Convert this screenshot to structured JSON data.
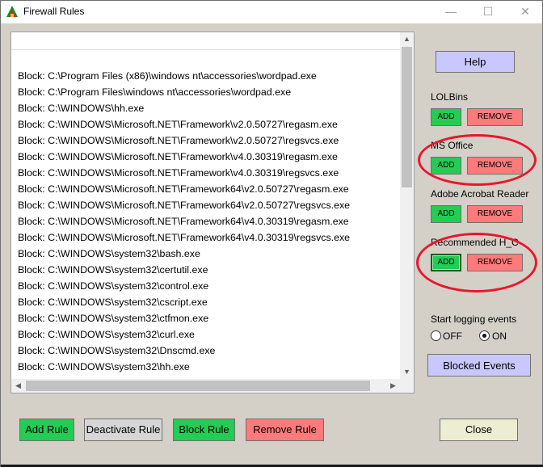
{
  "window": {
    "title": "Firewall Rules"
  },
  "title_controls": {
    "minimize": "—",
    "maximize": "☐",
    "close": "✕"
  },
  "rules": [
    "Block: C:\\Program Files (x86)\\windows nt\\accessories\\wordpad.exe",
    "Block: C:\\Program Files\\windows nt\\accessories\\wordpad.exe",
    "Block: C:\\WINDOWS\\hh.exe",
    "Block: C:\\WINDOWS\\Microsoft.NET\\Framework\\v2.0.50727\\regasm.exe",
    "Block: C:\\WINDOWS\\Microsoft.NET\\Framework\\v2.0.50727\\regsvcs.exe",
    "Block: C:\\WINDOWS\\Microsoft.NET\\Framework\\v4.0.30319\\regasm.exe",
    "Block: C:\\WINDOWS\\Microsoft.NET\\Framework\\v4.0.30319\\regsvcs.exe",
    "Block: C:\\WINDOWS\\Microsoft.NET\\Framework64\\v2.0.50727\\regasm.exe",
    "Block: C:\\WINDOWS\\Microsoft.NET\\Framework64\\v2.0.50727\\regsvcs.exe",
    "Block: C:\\WINDOWS\\Microsoft.NET\\Framework64\\v4.0.30319\\regasm.exe",
    "Block: C:\\WINDOWS\\Microsoft.NET\\Framework64\\v4.0.30319\\regsvcs.exe",
    "Block: C:\\WINDOWS\\system32\\bash.exe",
    "Block: C:\\WINDOWS\\system32\\certutil.exe",
    "Block: C:\\WINDOWS\\system32\\control.exe",
    "Block: C:\\WINDOWS\\system32\\cscript.exe",
    "Block: C:\\WINDOWS\\system32\\ctfmon.exe",
    "Block: C:\\WINDOWS\\system32\\curl.exe",
    "Block: C:\\WINDOWS\\system32\\Dnscmd.exe",
    "Block: C:\\WINDOWS\\system32\\hh.exe"
  ],
  "side": {
    "help_label": "Help",
    "groups": [
      {
        "name": "LOLBins",
        "add": "ADD",
        "remove": "REMOVE"
      },
      {
        "name": "MS Office",
        "add": "ADD",
        "remove": "REMOVE"
      },
      {
        "name": "Adobe Acrobat Reader",
        "add": "ADD",
        "remove": "REMOVE"
      },
      {
        "name": "Recommended H_C",
        "add": "ADD",
        "remove": "REMOVE"
      }
    ],
    "logging_label": "Start logging events",
    "logging_off": "OFF",
    "logging_on": "ON",
    "logging_selected": "ON",
    "blocked_events_label": "Blocked Events"
  },
  "bottom": {
    "add_rule": "Add Rule",
    "deactivate_rule": "Deactivate Rule",
    "block_rule": "Block Rule",
    "remove_rule": "Remove Rule",
    "close": "Close"
  },
  "colors": {
    "window_bg": "#d4d0c8",
    "add_green": "#22cc55",
    "remove_red": "#ff7b7b",
    "accent_blue": "#c8c8ff",
    "annotation_red": "#e8172b"
  }
}
